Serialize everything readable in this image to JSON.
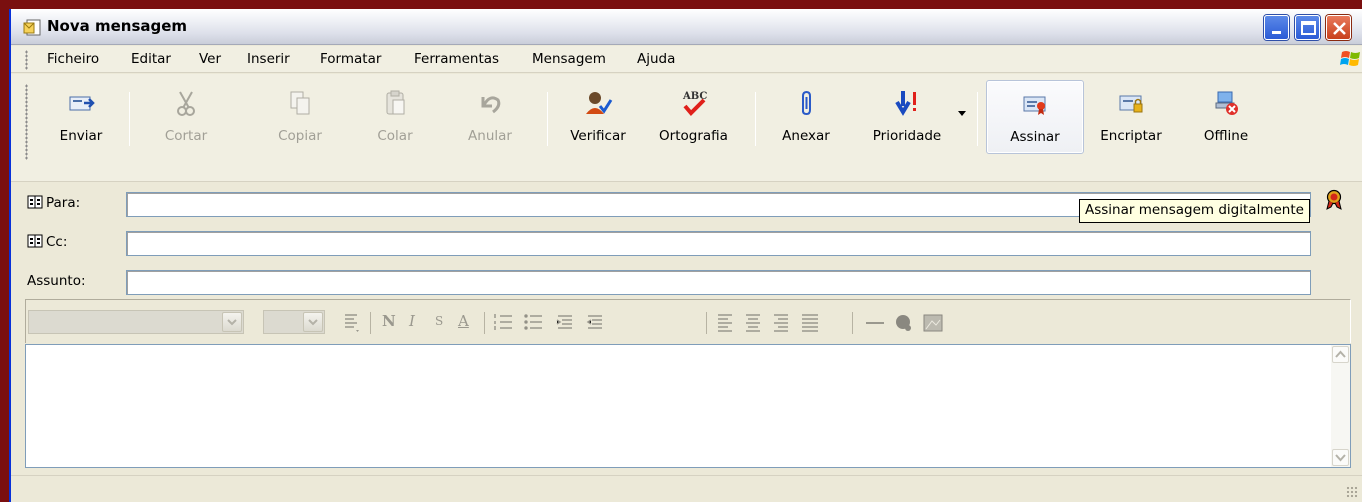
{
  "window": {
    "title": "Nova mensagem"
  },
  "menu": [
    "Ficheiro",
    "Editar",
    "Ver",
    "Inserir",
    "Formatar",
    "Ferramentas",
    "Mensagem",
    "Ajuda"
  ],
  "toolbar": {
    "send": "Enviar",
    "cut": "Cortar",
    "copy": "Copiar",
    "paste": "Colar",
    "undo": "Anular",
    "check": "Verificar",
    "spelling": "Ortografia",
    "attach": "Anexar",
    "priority": "Prioridade",
    "sign": "Assinar",
    "encrypt": "Encriptar",
    "offline": "Offline"
  },
  "header": {
    "to_label": "Para:",
    "cc_label": "Cc:",
    "subject_label": "Assunto:",
    "to_value": "",
    "cc_value": "",
    "subject_value": ""
  },
  "tooltip": "Assinar mensagem digitalmente",
  "format_glyphs": [
    "N",
    "I",
    "S",
    "A"
  ],
  "colors": {
    "title_frame": "#7a0f0f",
    "tooltip_bg": "#ffffe1",
    "disabled_text": "#a19f96"
  }
}
